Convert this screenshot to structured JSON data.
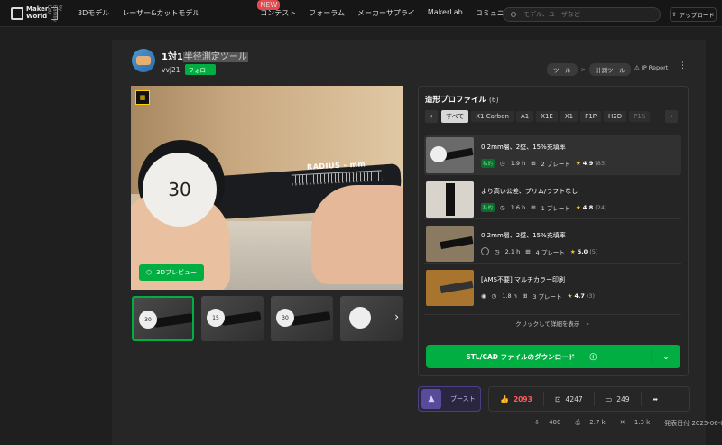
{
  "header": {
    "logo_line1": "Maker",
    "logo_line2": "World",
    "logo_side": "by Bambu Lab",
    "nav": [
      "3Dモデル",
      "レーザー&カットモデル",
      "コンテスト",
      "フォーラム",
      "メーカーサプライ",
      "MakerLab",
      "コミュニティ"
    ],
    "new_badge": "NEW",
    "search_placeholder": "モデル、ユーザなど",
    "upload": "アップロード"
  },
  "model": {
    "title_a": "1対1",
    "title_b": "半径測定ツール",
    "user": "vvj21",
    "follow": "フォロー",
    "crumbs": [
      "ツール",
      "計測ツール"
    ],
    "crumb_sep": ">",
    "ip_report": "IP Report",
    "preview_btn": "3Dプレビュー",
    "ruler_text": "RADIUS - mm",
    "disc_text": "30",
    "thumb_labels": [
      "30",
      "15",
      "30",
      ""
    ]
  },
  "profiles": {
    "title": "造形プロファイル",
    "count": "(6)",
    "filters": [
      "すべて",
      "X1 Carbon",
      "A1",
      "X1E",
      "X1",
      "P1P",
      "H2D",
      "P1S"
    ],
    "items": [
      {
        "name": "0.2mm層、2壁、15%充填率",
        "tag": "私的",
        "time": "1.9 h",
        "plates": "2 プレート",
        "rating": "4.9",
        "count": "(83)"
      },
      {
        "name": "より高い公差、ブリム/ラフトなし",
        "tag": "私的",
        "time": "1.6 h",
        "plates": "1 プレート",
        "rating": "4.8",
        "count": "(24)"
      },
      {
        "name": "0.2mm層、2壁、15%充填率",
        "tag": "",
        "time": "2.1 h",
        "plates": "4 プレート",
        "rating": "5.0",
        "count": "(5)"
      },
      {
        "name": "[AMS不要] マルチカラー印刷",
        "tag": "",
        "time": "1.8 h",
        "plates": "3 プレート",
        "rating": "4.7",
        "count": "(3)"
      }
    ],
    "more": "クリックして詳細を表示"
  },
  "download": {
    "label": "STL/CAD ファイルのダウンロード"
  },
  "actions": {
    "boost": "ブースト",
    "likes": "2093",
    "collects": "4247",
    "comments": "249"
  },
  "footer": {
    "downloads": "400",
    "prints": "2.7 k",
    "views": "1.3 k",
    "published": "発表日付 2025-06-06"
  },
  "colors": {
    "accent": "#00ae42",
    "background": "#1f1f1f"
  }
}
